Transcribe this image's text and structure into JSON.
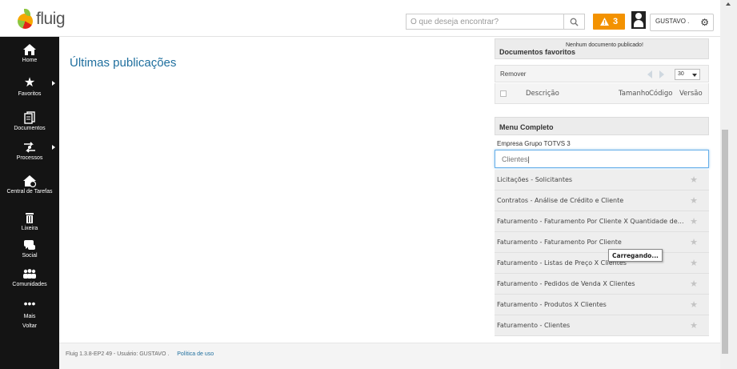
{
  "header": {
    "logo_text": "fluig",
    "search_placeholder": "O que deseja encontrar?",
    "alert_count": "3",
    "user_name": "GUSTAVO ."
  },
  "sidebar": {
    "items": [
      {
        "label": "Home",
        "icon": "home-icon"
      },
      {
        "label": "Favoritos",
        "icon": "star-icon"
      },
      {
        "label": "Documentos",
        "icon": "documents-icon"
      },
      {
        "label": "Processos",
        "icon": "processes-icon"
      },
      {
        "label": "Central de Tarefas",
        "icon": "task-center-icon"
      },
      {
        "label": "Lixeira",
        "icon": "trash-icon"
      },
      {
        "label": "Social",
        "icon": "chat-icon"
      },
      {
        "label": "Comunidades",
        "icon": "communities-icon"
      },
      {
        "label": "Mais",
        "icon": "more-icon"
      },
      {
        "label": "Voltar",
        "icon": ""
      }
    ]
  },
  "main": {
    "title": "Últimas publicações"
  },
  "docs_panel": {
    "title": "Documentos favoritos",
    "empty_note": "Nenhum documento publicado!",
    "remove_label": "Remover",
    "per_page": "30",
    "columns": [
      "Descrição",
      "Tamanho",
      "Código",
      "Versão"
    ]
  },
  "menu_panel": {
    "title": "Menu Completo",
    "company": "Empresa Grupo TOTVS 3",
    "filter_value": "Clientes",
    "items": [
      "Licitações - Solicitantes",
      "Contratos - Análise de Crédito e Cliente",
      "Faturamento - Faturamento Por Cliente X Quantidade de Pr...",
      "Faturamento - Faturamento Por Cliente",
      "Faturamento - Listas de Preço X Clientes",
      "Faturamento - Pedidos de Venda X Clientes",
      "Faturamento - Produtos X Clientes",
      "Faturamento - Clientes"
    ],
    "tooltip": "Carregando..."
  },
  "footer": {
    "version_text": "Fluig 1.3.8-EP2 49 - Usuário: GUSTAVO .",
    "policy_link": "Política de uso"
  },
  "colors": {
    "sidebar_bg": "#141414",
    "accent_blue": "#1f6f9e",
    "alert_orange": "#f39200"
  }
}
